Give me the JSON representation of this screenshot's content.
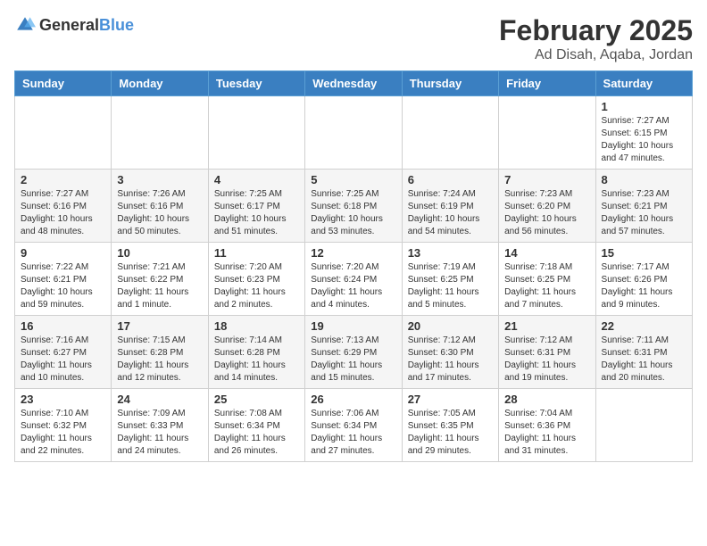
{
  "header": {
    "logo": {
      "general": "General",
      "blue": "Blue"
    },
    "title": "February 2025",
    "location": "Ad Disah, Aqaba, Jordan"
  },
  "weekdays": [
    "Sunday",
    "Monday",
    "Tuesday",
    "Wednesday",
    "Thursday",
    "Friday",
    "Saturday"
  ],
  "weeks": [
    [
      {
        "day": "",
        "info": ""
      },
      {
        "day": "",
        "info": ""
      },
      {
        "day": "",
        "info": ""
      },
      {
        "day": "",
        "info": ""
      },
      {
        "day": "",
        "info": ""
      },
      {
        "day": "",
        "info": ""
      },
      {
        "day": "1",
        "info": "Sunrise: 7:27 AM\nSunset: 6:15 PM\nDaylight: 10 hours and 47 minutes."
      }
    ],
    [
      {
        "day": "2",
        "info": "Sunrise: 7:27 AM\nSunset: 6:16 PM\nDaylight: 10 hours and 48 minutes."
      },
      {
        "day": "3",
        "info": "Sunrise: 7:26 AM\nSunset: 6:16 PM\nDaylight: 10 hours and 50 minutes."
      },
      {
        "day": "4",
        "info": "Sunrise: 7:25 AM\nSunset: 6:17 PM\nDaylight: 10 hours and 51 minutes."
      },
      {
        "day": "5",
        "info": "Sunrise: 7:25 AM\nSunset: 6:18 PM\nDaylight: 10 hours and 53 minutes."
      },
      {
        "day": "6",
        "info": "Sunrise: 7:24 AM\nSunset: 6:19 PM\nDaylight: 10 hours and 54 minutes."
      },
      {
        "day": "7",
        "info": "Sunrise: 7:23 AM\nSunset: 6:20 PM\nDaylight: 10 hours and 56 minutes."
      },
      {
        "day": "8",
        "info": "Sunrise: 7:23 AM\nSunset: 6:21 PM\nDaylight: 10 hours and 57 minutes."
      }
    ],
    [
      {
        "day": "9",
        "info": "Sunrise: 7:22 AM\nSunset: 6:21 PM\nDaylight: 10 hours and 59 minutes."
      },
      {
        "day": "10",
        "info": "Sunrise: 7:21 AM\nSunset: 6:22 PM\nDaylight: 11 hours and 1 minute."
      },
      {
        "day": "11",
        "info": "Sunrise: 7:20 AM\nSunset: 6:23 PM\nDaylight: 11 hours and 2 minutes."
      },
      {
        "day": "12",
        "info": "Sunrise: 7:20 AM\nSunset: 6:24 PM\nDaylight: 11 hours and 4 minutes."
      },
      {
        "day": "13",
        "info": "Sunrise: 7:19 AM\nSunset: 6:25 PM\nDaylight: 11 hours and 5 minutes."
      },
      {
        "day": "14",
        "info": "Sunrise: 7:18 AM\nSunset: 6:25 PM\nDaylight: 11 hours and 7 minutes."
      },
      {
        "day": "15",
        "info": "Sunrise: 7:17 AM\nSunset: 6:26 PM\nDaylight: 11 hours and 9 minutes."
      }
    ],
    [
      {
        "day": "16",
        "info": "Sunrise: 7:16 AM\nSunset: 6:27 PM\nDaylight: 11 hours and 10 minutes."
      },
      {
        "day": "17",
        "info": "Sunrise: 7:15 AM\nSunset: 6:28 PM\nDaylight: 11 hours and 12 minutes."
      },
      {
        "day": "18",
        "info": "Sunrise: 7:14 AM\nSunset: 6:28 PM\nDaylight: 11 hours and 14 minutes."
      },
      {
        "day": "19",
        "info": "Sunrise: 7:13 AM\nSunset: 6:29 PM\nDaylight: 11 hours and 15 minutes."
      },
      {
        "day": "20",
        "info": "Sunrise: 7:12 AM\nSunset: 6:30 PM\nDaylight: 11 hours and 17 minutes."
      },
      {
        "day": "21",
        "info": "Sunrise: 7:12 AM\nSunset: 6:31 PM\nDaylight: 11 hours and 19 minutes."
      },
      {
        "day": "22",
        "info": "Sunrise: 7:11 AM\nSunset: 6:31 PM\nDaylight: 11 hours and 20 minutes."
      }
    ],
    [
      {
        "day": "23",
        "info": "Sunrise: 7:10 AM\nSunset: 6:32 PM\nDaylight: 11 hours and 22 minutes."
      },
      {
        "day": "24",
        "info": "Sunrise: 7:09 AM\nSunset: 6:33 PM\nDaylight: 11 hours and 24 minutes."
      },
      {
        "day": "25",
        "info": "Sunrise: 7:08 AM\nSunset: 6:34 PM\nDaylight: 11 hours and 26 minutes."
      },
      {
        "day": "26",
        "info": "Sunrise: 7:06 AM\nSunset: 6:34 PM\nDaylight: 11 hours and 27 minutes."
      },
      {
        "day": "27",
        "info": "Sunrise: 7:05 AM\nSunset: 6:35 PM\nDaylight: 11 hours and 29 minutes."
      },
      {
        "day": "28",
        "info": "Sunrise: 7:04 AM\nSunset: 6:36 PM\nDaylight: 11 hours and 31 minutes."
      },
      {
        "day": "",
        "info": ""
      }
    ]
  ]
}
